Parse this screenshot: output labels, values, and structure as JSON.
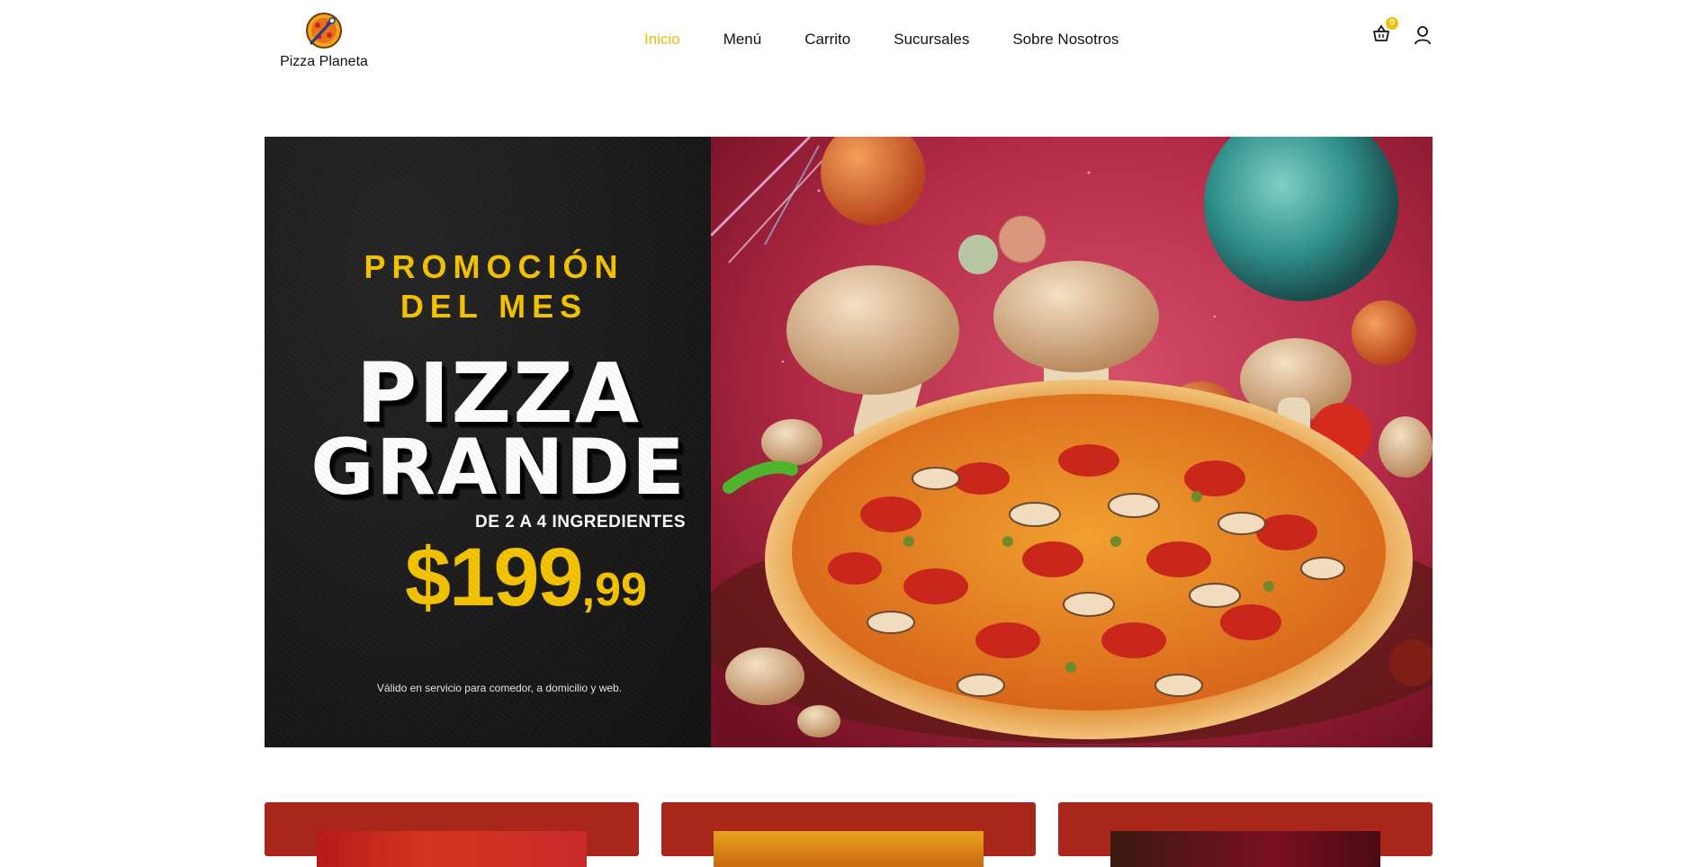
{
  "header": {
    "logo_text": "Pizza Planeta",
    "logo_icon": "pizza-planet-logo",
    "nav": [
      {
        "label": "Inicio",
        "active": true
      },
      {
        "label": "Menú",
        "active": false
      },
      {
        "label": "Carrito",
        "active": false
      },
      {
        "label": "Sucursales",
        "active": false
      },
      {
        "label": "Sobre Nosotros",
        "active": false
      }
    ],
    "cart_count": "0",
    "cart_icon": "basket-icon",
    "user_icon": "user-icon"
  },
  "banner": {
    "promo_line1": "PROMOCIÓN",
    "promo_line2": "DEL MES",
    "product_line1": "PIZZA",
    "product_line2": "GRANDE",
    "ingredients": "DE 2 A 4 INGREDIENTES",
    "price_main": "$199",
    "price_cents": ",99",
    "validity": "Válido en servicio para comedor, a domicilio y web.",
    "image_subject": "pepperoni-mushroom-pizza-space-scene"
  },
  "cards": [
    {
      "image": "planets-space-pizza"
    },
    {
      "image": "orange-pizza-box"
    },
    {
      "image": "dark-red-pizza"
    }
  ],
  "colors": {
    "accent": "#f2b705",
    "promo_yellow": "#f5c400",
    "card_red": "#a8261a",
    "panel_black": "#1c1c1c"
  }
}
